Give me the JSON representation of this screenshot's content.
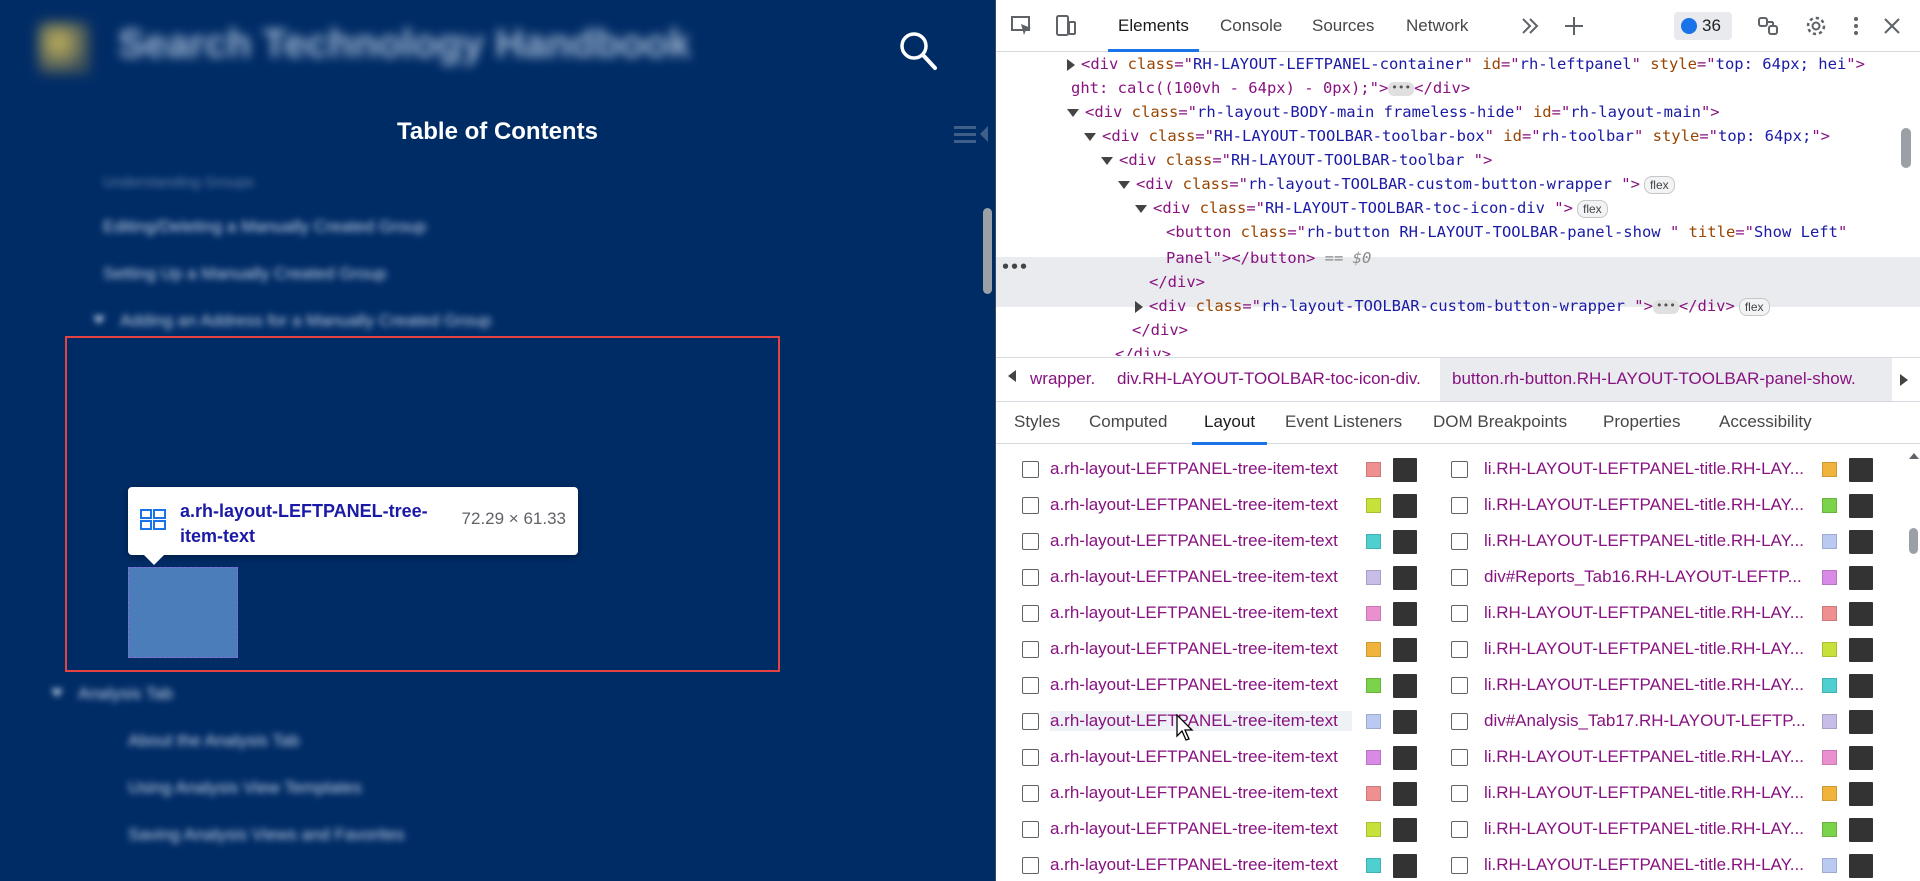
{
  "left": {
    "site_logo": "site-logo",
    "site_title": "Search Technology Handbook",
    "toc_title": "Table of Contents",
    "toc_items": [
      {
        "label": "Understanding Groups",
        "chevron": false
      },
      {
        "label": "Editing/Deleting a Manually Created Group",
        "chevron": false
      },
      {
        "label": "Setting Up a Manually Created Group",
        "chevron": false
      },
      {
        "label": "Adding an Address for a Manually Created Group",
        "chevron": true
      },
      {
        "label": "Analysis Tab",
        "chevron": true
      },
      {
        "label": "About the Analysis Tab",
        "chevron": false
      },
      {
        "label": "Using Analysis View Templates",
        "chevron": false
      },
      {
        "label": "Saving Analysis Views and Favorites",
        "chevron": false
      }
    ],
    "tooltip": {
      "selector": "a.rh-layout-LEFTPANEL-tree-item-text",
      "dims": "72.29 × 61.33"
    }
  },
  "devtools": {
    "tabs": [
      "Elements",
      "Console",
      "Sources",
      "Network"
    ],
    "active_tab": "Elements",
    "issues_count": "36",
    "dom_lines": [
      {
        "indent": 0,
        "arrow": "closed",
        "tag": "div",
        "attrs": [
          [
            "class",
            "RH-LAYOUT-LEFTPANEL-container"
          ],
          [
            "id",
            "rh-leftpanel"
          ],
          [
            "style",
            "top: 64px; hei"
          ]
        ],
        "tail": "",
        "ellipsis": false,
        "badge": ""
      },
      {
        "indent": 0,
        "arrow": "none",
        "tag": "",
        "attrs": [],
        "text": "ght: calc((100vh - 64px) - 0px);\">",
        "ellipsis": true,
        "tail": "</div>",
        "badge": ""
      },
      {
        "indent": 0,
        "arrow": "open",
        "tag": "div",
        "attrs": [
          [
            "class",
            "rh-layout-BODY-main frameless-hide"
          ],
          [
            "id",
            "rh-layout-main"
          ]
        ],
        "tail": "",
        "ellipsis": false,
        "badge": ""
      },
      {
        "indent": 1,
        "arrow": "open",
        "tag": "div",
        "attrs": [
          [
            "class",
            "RH-LAYOUT-TOOLBAR-toolbar-box"
          ],
          [
            "id",
            "rh-toolbar"
          ],
          [
            "style",
            "top: 64px;"
          ]
        ],
        "tail": "",
        "ellipsis": false,
        "badge": ""
      },
      {
        "indent": 2,
        "arrow": "open",
        "tag": "div",
        "attrs": [
          [
            "class",
            "RH-LAYOUT-TOOLBAR-toolbar "
          ]
        ],
        "tail": "",
        "ellipsis": false,
        "badge": ""
      },
      {
        "indent": 3,
        "arrow": "open",
        "tag": "div",
        "attrs": [
          [
            "class",
            "rh-layout-TOOLBAR-custom-button-wrapper "
          ]
        ],
        "tail": "",
        "ellipsis": false,
        "badge": "flex"
      },
      {
        "indent": 4,
        "arrow": "open",
        "tag": "div",
        "attrs": [
          [
            "class",
            "RH-LAYOUT-TOOLBAR-toc-icon-div "
          ]
        ],
        "tail": "",
        "ellipsis": false,
        "badge": "flex"
      },
      {
        "indent": 5,
        "arrow": "none",
        "tag": "button",
        "attrs": [
          [
            "class",
            "rh-button RH-LAYOUT-TOOLBAR-panel-show  "
          ],
          [
            "title",
            "Show Left"
          ]
        ],
        "tail": "",
        "ellipsis": false,
        "badge": "",
        "selected": true
      },
      {
        "indent": 5,
        "arrow": "none",
        "tag": "",
        "attrs": [],
        "text": "Panel\"></button>",
        "suffix": " == $0",
        "ellipsis": false,
        "tail": "",
        "badge": "",
        "selected": true
      },
      {
        "indent": 4,
        "arrow": "none",
        "tag": "",
        "attrs": [],
        "text": "</div>",
        "ellipsis": false,
        "tail": "",
        "badge": ""
      },
      {
        "indent": 4,
        "arrow": "closed",
        "tag": "div",
        "attrs": [
          [
            "class",
            "rh-layout-TOOLBAR-custom-button-wrapper "
          ]
        ],
        "tail": "</div>",
        "ellipsis": true,
        "badge": "flex"
      },
      {
        "indent": 3,
        "arrow": "none",
        "tag": "",
        "attrs": [],
        "text": "</div>",
        "ellipsis": false,
        "tail": "",
        "badge": ""
      },
      {
        "indent": 2,
        "arrow": "none",
        "tag": "",
        "attrs": [],
        "text": "</div>",
        "ellipsis": false,
        "tail": "",
        "badge": ""
      }
    ],
    "breadcrumbs": [
      "wrapper.",
      "div.RH-LAYOUT-TOOLBAR-toc-icon-div.",
      "button.rh-button.RH-LAYOUT-TOOLBAR-panel-show."
    ],
    "subtabs": [
      "Styles",
      "Computed",
      "Layout",
      "Event Listeners",
      "DOM Breakpoints",
      "Properties",
      "Accessibility"
    ],
    "active_subtab": "Layout",
    "layout_rows": [
      {
        "left": "a.rh-layout-LEFTPANEL-tree-item-text",
        "lc": "#f08f8f",
        "right": "li.RH-LAYOUT-LEFTPANEL-title.RH-LAY...",
        "rc": "#f0b43c"
      },
      {
        "left": "a.rh-layout-LEFTPANEL-tree-item-text",
        "lc": "#c8e03a",
        "right": "li.RH-LAYOUT-LEFTPANEL-title.RH-LAY...",
        "rc": "#7bd34a"
      },
      {
        "left": "a.rh-layout-LEFTPANEL-tree-item-text",
        "lc": "#4fcfcf",
        "right": "li.RH-LAYOUT-LEFTPANEL-title.RH-LAY...",
        "rc": "#b9c9f2"
      },
      {
        "left": "a.rh-layout-LEFTPANEL-tree-item-text",
        "lc": "#c7bde8",
        "right": "div#Reports_Tab16.RH-LAYOUT-LEFTP...",
        "rc": "#d98ae6"
      },
      {
        "left": "a.rh-layout-LEFTPANEL-tree-item-text",
        "lc": "#ea8fcf",
        "right": "li.RH-LAYOUT-LEFTPANEL-title.RH-LAY...",
        "rc": "#f08f8f"
      },
      {
        "left": "a.rh-layout-LEFTPANEL-tree-item-text",
        "lc": "#f0b43c",
        "right": "li.RH-LAYOUT-LEFTPANEL-title.RH-LAY...",
        "rc": "#c8e03a"
      },
      {
        "left": "a.rh-layout-LEFTPANEL-tree-item-text",
        "lc": "#7bd34a",
        "right": "li.RH-LAYOUT-LEFTPANEL-title.RH-LAY...",
        "rc": "#4fcfcf"
      },
      {
        "left": "a.rh-layout-LEFTPANEL-tree-item-text",
        "lc": "#b9c9f2",
        "right": "div#Analysis_Tab17.RH-LAYOUT-LEFTP...",
        "rc": "#c7bde8",
        "hover": true
      },
      {
        "left": "a.rh-layout-LEFTPANEL-tree-item-text",
        "lc": "#d98ae6",
        "right": "li.RH-LAYOUT-LEFTPANEL-title.RH-LAY...",
        "rc": "#ea8fcf"
      },
      {
        "left": "a.rh-layout-LEFTPANEL-tree-item-text",
        "lc": "#f08f8f",
        "right": "li.RH-LAYOUT-LEFTPANEL-title.RH-LAY...",
        "rc": "#f0b43c"
      },
      {
        "left": "a.rh-layout-LEFTPANEL-tree-item-text",
        "lc": "#c8e03a",
        "right": "li.RH-LAYOUT-LEFTPANEL-title.RH-LAY...",
        "rc": "#7bd34a"
      },
      {
        "left": "a.rh-layout-LEFTPANEL-tree-item-text",
        "lc": "#4fcfcf",
        "right": "li.RH-LAYOUT-LEFTPANEL-title.RH-LAY...",
        "rc": "#b9c9f2"
      }
    ],
    "colors": {
      "accent": "#1a73e8",
      "tag": "#881280",
      "attr_name": "#994500",
      "attr_value": "#1a1aa6",
      "page_bg": "#002c66",
      "highlight": "#e54343"
    }
  }
}
